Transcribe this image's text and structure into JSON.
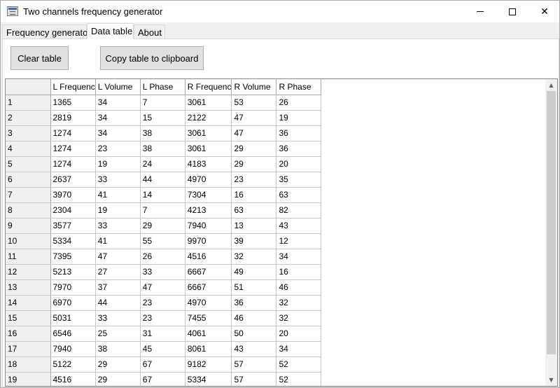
{
  "window": {
    "title": "Two channels frequency generator",
    "controls": {
      "minimize": "minimize-icon",
      "maximize": "maximize-icon",
      "close": "close-icon"
    }
  },
  "tabs": [
    {
      "label": "Frequency generator",
      "active": false
    },
    {
      "label": "Data table",
      "active": true
    },
    {
      "label": "About",
      "active": false
    }
  ],
  "toolbar": {
    "clear_label": "Clear table",
    "copy_label": "Copy table to clipboard"
  },
  "table": {
    "columns": [
      "",
      "L Frequenc",
      "L Volume",
      "L Phase",
      "R Frequenc",
      "R Volume",
      "R Phase"
    ],
    "rows": [
      [
        "1",
        "1365",
        "34",
        "7",
        "3061",
        "53",
        "26"
      ],
      [
        "2",
        "2819",
        "34",
        "15",
        "2122",
        "47",
        "19"
      ],
      [
        "3",
        "1274",
        "34",
        "38",
        "3061",
        "47",
        "36"
      ],
      [
        "4",
        "1274",
        "23",
        "38",
        "3061",
        "29",
        "36"
      ],
      [
        "5",
        "1274",
        "19",
        "24",
        "4183",
        "29",
        "20"
      ],
      [
        "6",
        "2637",
        "33",
        "44",
        "4970",
        "23",
        "35"
      ],
      [
        "7",
        "3970",
        "41",
        "14",
        "7304",
        "16",
        "63"
      ],
      [
        "8",
        "2304",
        "19",
        "7",
        "4213",
        "63",
        "82"
      ],
      [
        "9",
        "3577",
        "33",
        "29",
        "7940",
        "13",
        "43"
      ],
      [
        "10",
        "5334",
        "41",
        "55",
        "9970",
        "39",
        "12"
      ],
      [
        "11",
        "7395",
        "47",
        "26",
        "4516",
        "32",
        "34"
      ],
      [
        "12",
        "5213",
        "27",
        "33",
        "6667",
        "49",
        "16"
      ],
      [
        "13",
        "7970",
        "37",
        "47",
        "6667",
        "51",
        "46"
      ],
      [
        "14",
        "6970",
        "44",
        "23",
        "4970",
        "36",
        "32"
      ],
      [
        "15",
        "5031",
        "33",
        "23",
        "7455",
        "46",
        "32"
      ],
      [
        "16",
        "6546",
        "25",
        "31",
        "4061",
        "50",
        "20"
      ],
      [
        "17",
        "7940",
        "38",
        "45",
        "8061",
        "43",
        "34"
      ],
      [
        "18",
        "5122",
        "29",
        "67",
        "9182",
        "57",
        "52"
      ],
      [
        "19",
        "4516",
        "29",
        "67",
        "5334",
        "57",
        "52"
      ]
    ]
  },
  "scrollbar": {
    "up_icon": "scroll-up-arrow-icon",
    "down_icon": "scroll-down-arrow-icon"
  }
}
